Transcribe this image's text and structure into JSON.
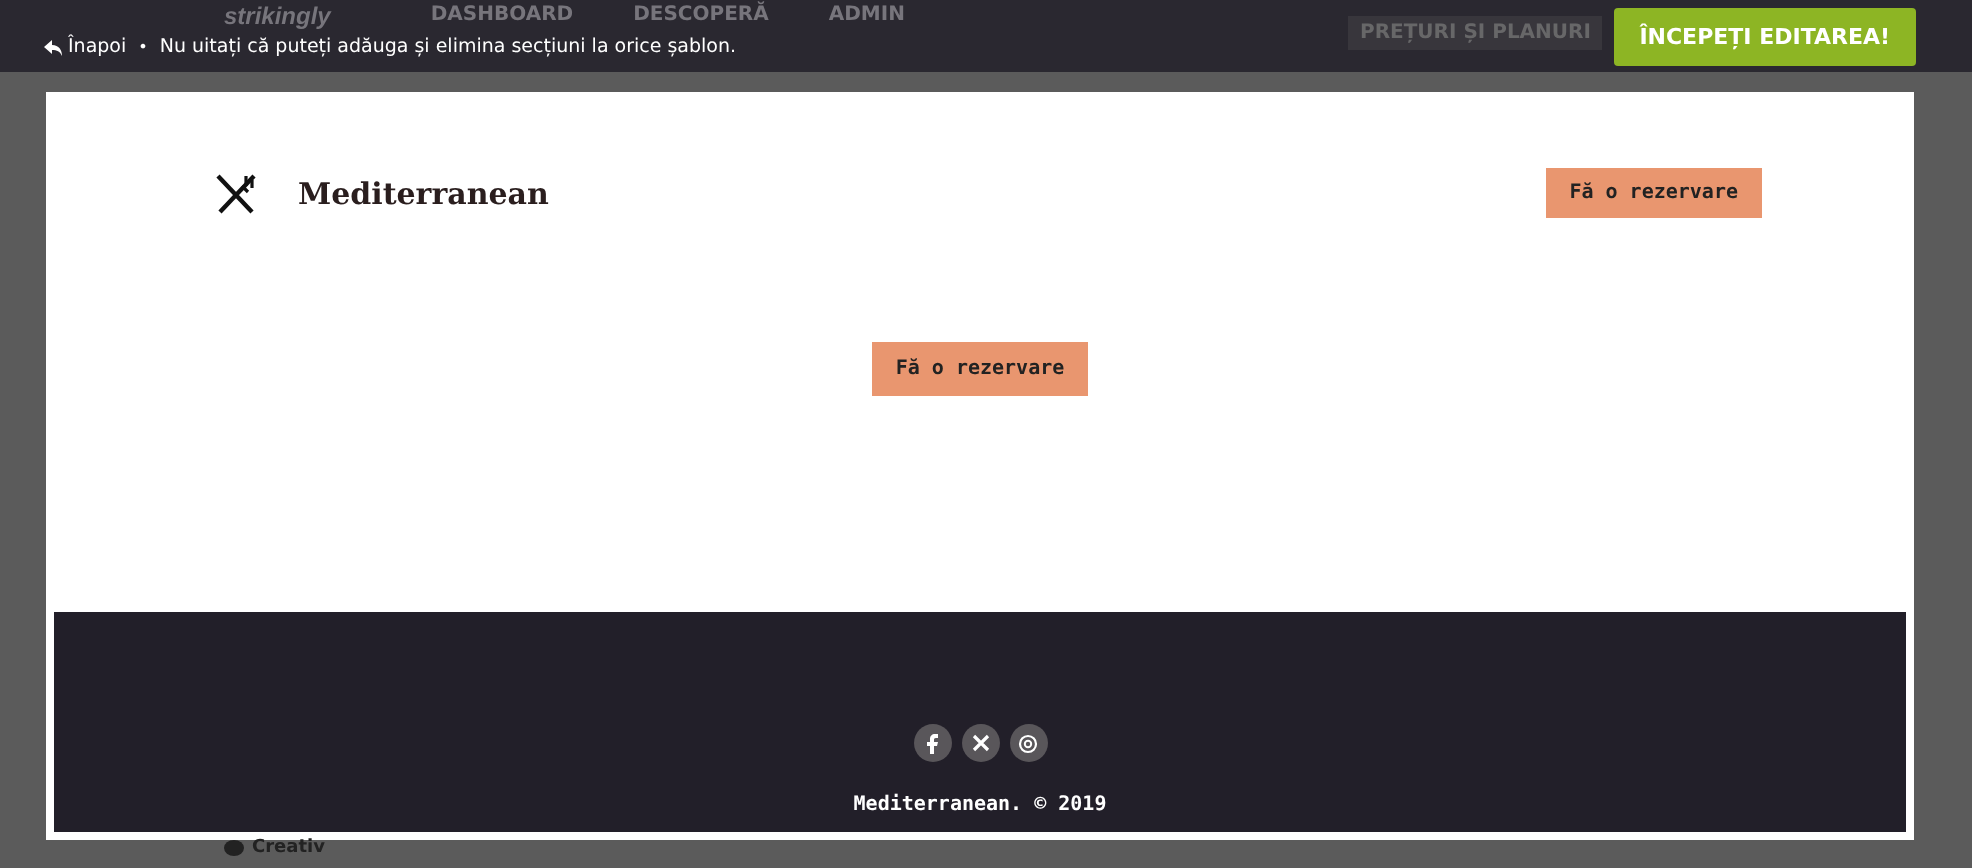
{
  "topbar": {
    "back_link": "Înapoi",
    "separator": "•",
    "notice": "Nu uitați că puteți adăuga și elimina secțiuni la orice șablon.",
    "background_nav": {
      "logo": "strikingly",
      "items": [
        "DASHBOARD",
        "DESCOPERĂ",
        "ADMIN"
      ],
      "pricing": "PREȚURI ȘI PLANURI"
    },
    "start_button": "ÎNCEPEȚI EDITAREA!"
  },
  "preview": {
    "brand": "Mediterranean",
    "header_button": "Fă o rezervare",
    "hero_button": "Fă o rezervare",
    "footer": {
      "social": [
        {
          "kind": "facebook"
        },
        {
          "kind": "x"
        },
        {
          "kind": "email"
        }
      ],
      "copyright": "Mediterranean. © 2019"
    }
  },
  "behind": {
    "label": "Creativ"
  }
}
